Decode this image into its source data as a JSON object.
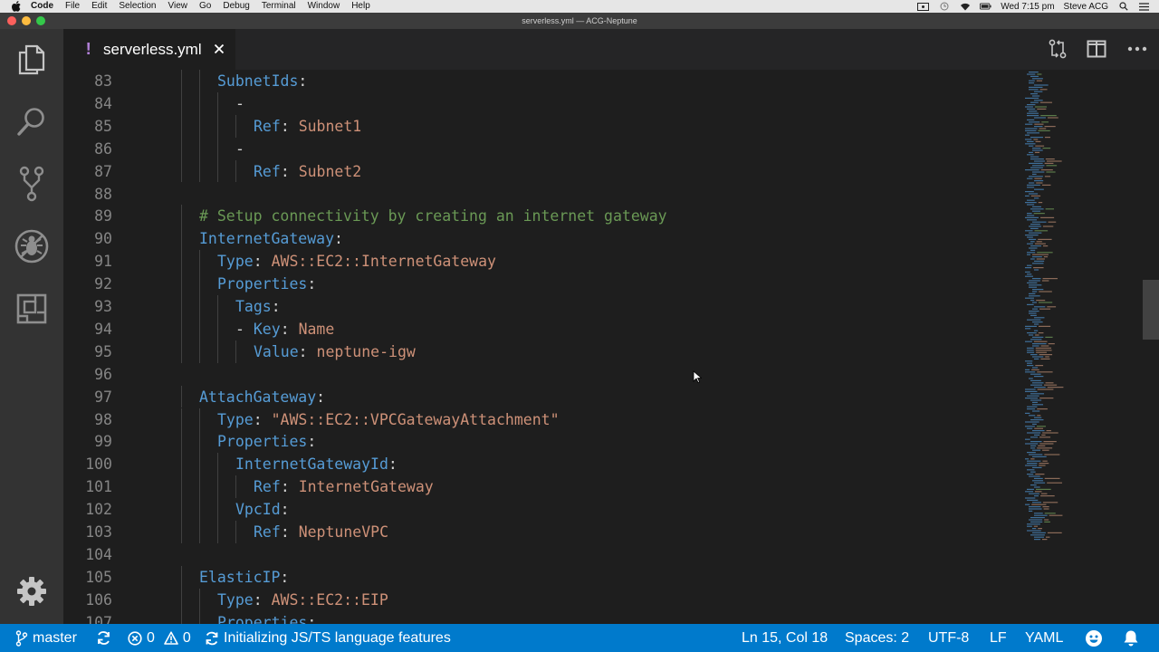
{
  "menubar": {
    "app": "Code",
    "items": [
      "File",
      "Edit",
      "Selection",
      "View",
      "Go",
      "Debug",
      "Terminal",
      "Window",
      "Help"
    ],
    "clock": "Wed 7:15 pm",
    "user": "Steve ACG"
  },
  "window": {
    "title": "serverless.yml — ACG-Neptune"
  },
  "tab": {
    "modified_marker": "!",
    "name": "serverless.yml"
  },
  "editor": {
    "lines": [
      {
        "n": "83",
        "tokens": [
          {
            "t": "SubnetIds",
            "c": "k"
          },
          {
            "t": ":",
            "c": "p"
          }
        ]
      },
      {
        "n": "84",
        "tokens": [
          {
            "t": "-",
            "c": "p"
          }
        ]
      },
      {
        "n": "85",
        "tokens": [
          {
            "t": "Ref",
            "c": "k"
          },
          {
            "t": ": ",
            "c": "p"
          },
          {
            "t": "Subnet1",
            "c": "s"
          }
        ]
      },
      {
        "n": "86",
        "tokens": [
          {
            "t": "-",
            "c": "p"
          }
        ]
      },
      {
        "n": "87",
        "tokens": [
          {
            "t": "Ref",
            "c": "k"
          },
          {
            "t": ": ",
            "c": "p"
          },
          {
            "t": "Subnet2",
            "c": "s"
          }
        ]
      },
      {
        "n": "88",
        "tokens": []
      },
      {
        "n": "89",
        "tokens": [
          {
            "t": "# Setup connectivity by creating an internet gateway",
            "c": "c"
          }
        ]
      },
      {
        "n": "90",
        "tokens": [
          {
            "t": "InternetGateway",
            "c": "k"
          },
          {
            "t": ":",
            "c": "p"
          }
        ]
      },
      {
        "n": "91",
        "tokens": [
          {
            "t": "Type",
            "c": "k"
          },
          {
            "t": ": ",
            "c": "p"
          },
          {
            "t": "AWS::EC2::InternetGateway",
            "c": "s"
          }
        ]
      },
      {
        "n": "92",
        "tokens": [
          {
            "t": "Properties",
            "c": "k"
          },
          {
            "t": ":",
            "c": "p"
          }
        ]
      },
      {
        "n": "93",
        "tokens": [
          {
            "t": "Tags",
            "c": "k"
          },
          {
            "t": ":",
            "c": "p"
          }
        ]
      },
      {
        "n": "94",
        "tokens": [
          {
            "t": "- ",
            "c": "p"
          },
          {
            "t": "Key",
            "c": "k"
          },
          {
            "t": ": ",
            "c": "p"
          },
          {
            "t": "Name",
            "c": "s"
          }
        ]
      },
      {
        "n": "95",
        "tokens": [
          {
            "t": "Value",
            "c": "k"
          },
          {
            "t": ": ",
            "c": "p"
          },
          {
            "t": "neptune-igw",
            "c": "s"
          }
        ]
      },
      {
        "n": "96",
        "tokens": []
      },
      {
        "n": "97",
        "tokens": [
          {
            "t": "AttachGateway",
            "c": "k"
          },
          {
            "t": ":",
            "c": "p"
          }
        ]
      },
      {
        "n": "98",
        "tokens": [
          {
            "t": "Type",
            "c": "k"
          },
          {
            "t": ": ",
            "c": "p"
          },
          {
            "t": "\"AWS::EC2::VPCGatewayAttachment\"",
            "c": "s"
          }
        ]
      },
      {
        "n": "99",
        "tokens": [
          {
            "t": "Properties",
            "c": "k"
          },
          {
            "t": ":",
            "c": "p"
          }
        ]
      },
      {
        "n": "100",
        "tokens": [
          {
            "t": "InternetGatewayId",
            "c": "k"
          },
          {
            "t": ":",
            "c": "p"
          }
        ]
      },
      {
        "n": "101",
        "tokens": [
          {
            "t": "Ref",
            "c": "k"
          },
          {
            "t": ": ",
            "c": "p"
          },
          {
            "t": "InternetGateway",
            "c": "s"
          }
        ]
      },
      {
        "n": "102",
        "tokens": [
          {
            "t": "VpcId",
            "c": "k"
          },
          {
            "t": ":",
            "c": "p"
          }
        ]
      },
      {
        "n": "103",
        "tokens": [
          {
            "t": "Ref",
            "c": "k"
          },
          {
            "t": ": ",
            "c": "p"
          },
          {
            "t": "NeptuneVPC",
            "c": "s"
          }
        ]
      },
      {
        "n": "104",
        "tokens": []
      },
      {
        "n": "105",
        "tokens": [
          {
            "t": "ElasticIP",
            "c": "k"
          },
          {
            "t": ":",
            "c": "p"
          }
        ]
      },
      {
        "n": "106",
        "tokens": [
          {
            "t": "Type",
            "c": "k"
          },
          {
            "t": ": ",
            "c": "p"
          },
          {
            "t": "AWS::EC2::EIP",
            "c": "s"
          }
        ]
      },
      {
        "n": "107",
        "tokens": [
          {
            "t": "Properties",
            "c": "k"
          },
          {
            "t": ":",
            "c": "p"
          }
        ]
      }
    ]
  },
  "statusbar": {
    "branch": "master",
    "errors": "0",
    "warnings": "0",
    "task": "Initializing JS/TS language features",
    "position": "Ln 15, Col 18",
    "indent": "Spaces: 2",
    "encoding": "UTF-8",
    "eol": "LF",
    "language": "YAML"
  },
  "icons": {
    "activity": [
      "files-icon",
      "search-icon",
      "source-control-icon",
      "debug-icon",
      "extensions-icon",
      "settings-gear-icon"
    ],
    "tab_actions": [
      "open-changes-icon",
      "split-editor-icon",
      "more-actions-icon"
    ]
  },
  "colors": {
    "keyword": "#569cd6",
    "string": "#ce9178",
    "comment": "#6a9955",
    "statusbar": "#007acc",
    "modified_marker": "#b180d7"
  }
}
